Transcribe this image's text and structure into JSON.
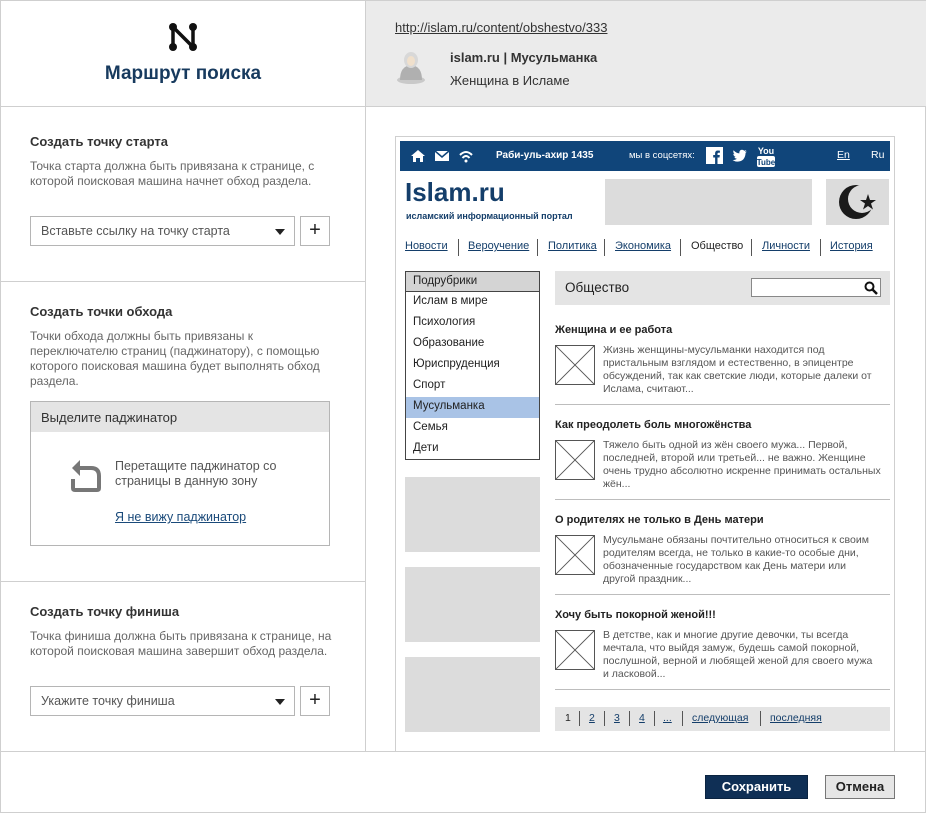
{
  "brand": {
    "title": "Маршрут поиска",
    "icon": "route-node-icon"
  },
  "start": {
    "title": "Создать точку старта",
    "desc": "Точка старта должна быть привязана к странице, с которой поисковая машина начнет обход раздела.",
    "placeholder": "Вставьте ссылку на точку старта",
    "add_label": "+"
  },
  "crawl": {
    "title": "Создать точки обхода",
    "desc": "Точки обхода должны быть привязаны к переключателю страниц (паджинатору), с помощью которого поисковая машина будет выполнять обход раздела.",
    "box_title": "Выделите паджинатор",
    "drop_hint": "Перетащите паджинатор со страницы в данную зону",
    "no_pager_link": "Я не вижу паджинатор"
  },
  "finish": {
    "title": "Создать точку финиша",
    "desc": "Точка финиша должна быть привязана к странице, на которой поисковая машина завершит обход раздела.",
    "placeholder": "Укажите точку финиша",
    "add_label": "+"
  },
  "page_info": {
    "url": "http://islam.ru/content/obshestvo/333",
    "site_name": "islam.ru | Мусульманка",
    "subtitle": "Женщина в Исламе"
  },
  "preview": {
    "date": "Раби-уль-ахир 1435",
    "social": "мы в соцсетях:",
    "lang_en": "En",
    "lang_ru": "Ru",
    "logo": "Islam.ru",
    "logo_sub": "исламский информационный портал",
    "nav": [
      "Новости",
      "Вероучение",
      "Политика",
      "Экономика",
      "Общество",
      "Личности",
      "История"
    ],
    "nav_current": "Общество",
    "rubrics_head": "Подрубрики",
    "rubrics": [
      "Ислам в мире",
      "Психология",
      "Образование",
      "Юриспруденция",
      "Спорт",
      "Мусульманка",
      "Семья",
      "Дети"
    ],
    "rubric_selected": "Мусульманка",
    "section_title": "Общество",
    "articles": [
      {
        "title": "Женщина и ее работа",
        "text": "Жизнь женщины-мусульманки находится под пристальным взглядом и естественно, в эпицентре обсуждений, так как светские люди, которые далеки от Ислама, считают..."
      },
      {
        "title": "Как преодолеть боль многожёнства",
        "text": "Тяжело быть одной из жён своего мужа... Первой, последней, второй или третьей... не важно. Женщине очень трудно абсолютно искренне принимать остальных жён..."
      },
      {
        "title": "О родителях не только в День матери",
        "text": "Мусульмане обязаны почтительно относиться к своим родителям всегда, не только в какие-то особые дни, обозначенные государством как День матери или другой праздник..."
      },
      {
        "title": "Хочу быть покорной женой!!!",
        "text": "В детстве, как и многие другие девочки, ты всегда мечтала, что выйдя замуж, будешь самой покорной, послушной, верной и любящей женой для своего мужа и ласковой..."
      }
    ],
    "pager": [
      "1",
      "2",
      "3",
      "4",
      "...",
      "следующая",
      "последняя"
    ]
  },
  "footer": {
    "save": "Сохранить",
    "cancel": "Отмена"
  },
  "colors": {
    "accent": "#0f2f55",
    "brand": "#173a5e",
    "topbar": "#10457a",
    "selected": "#a9c3e6"
  }
}
